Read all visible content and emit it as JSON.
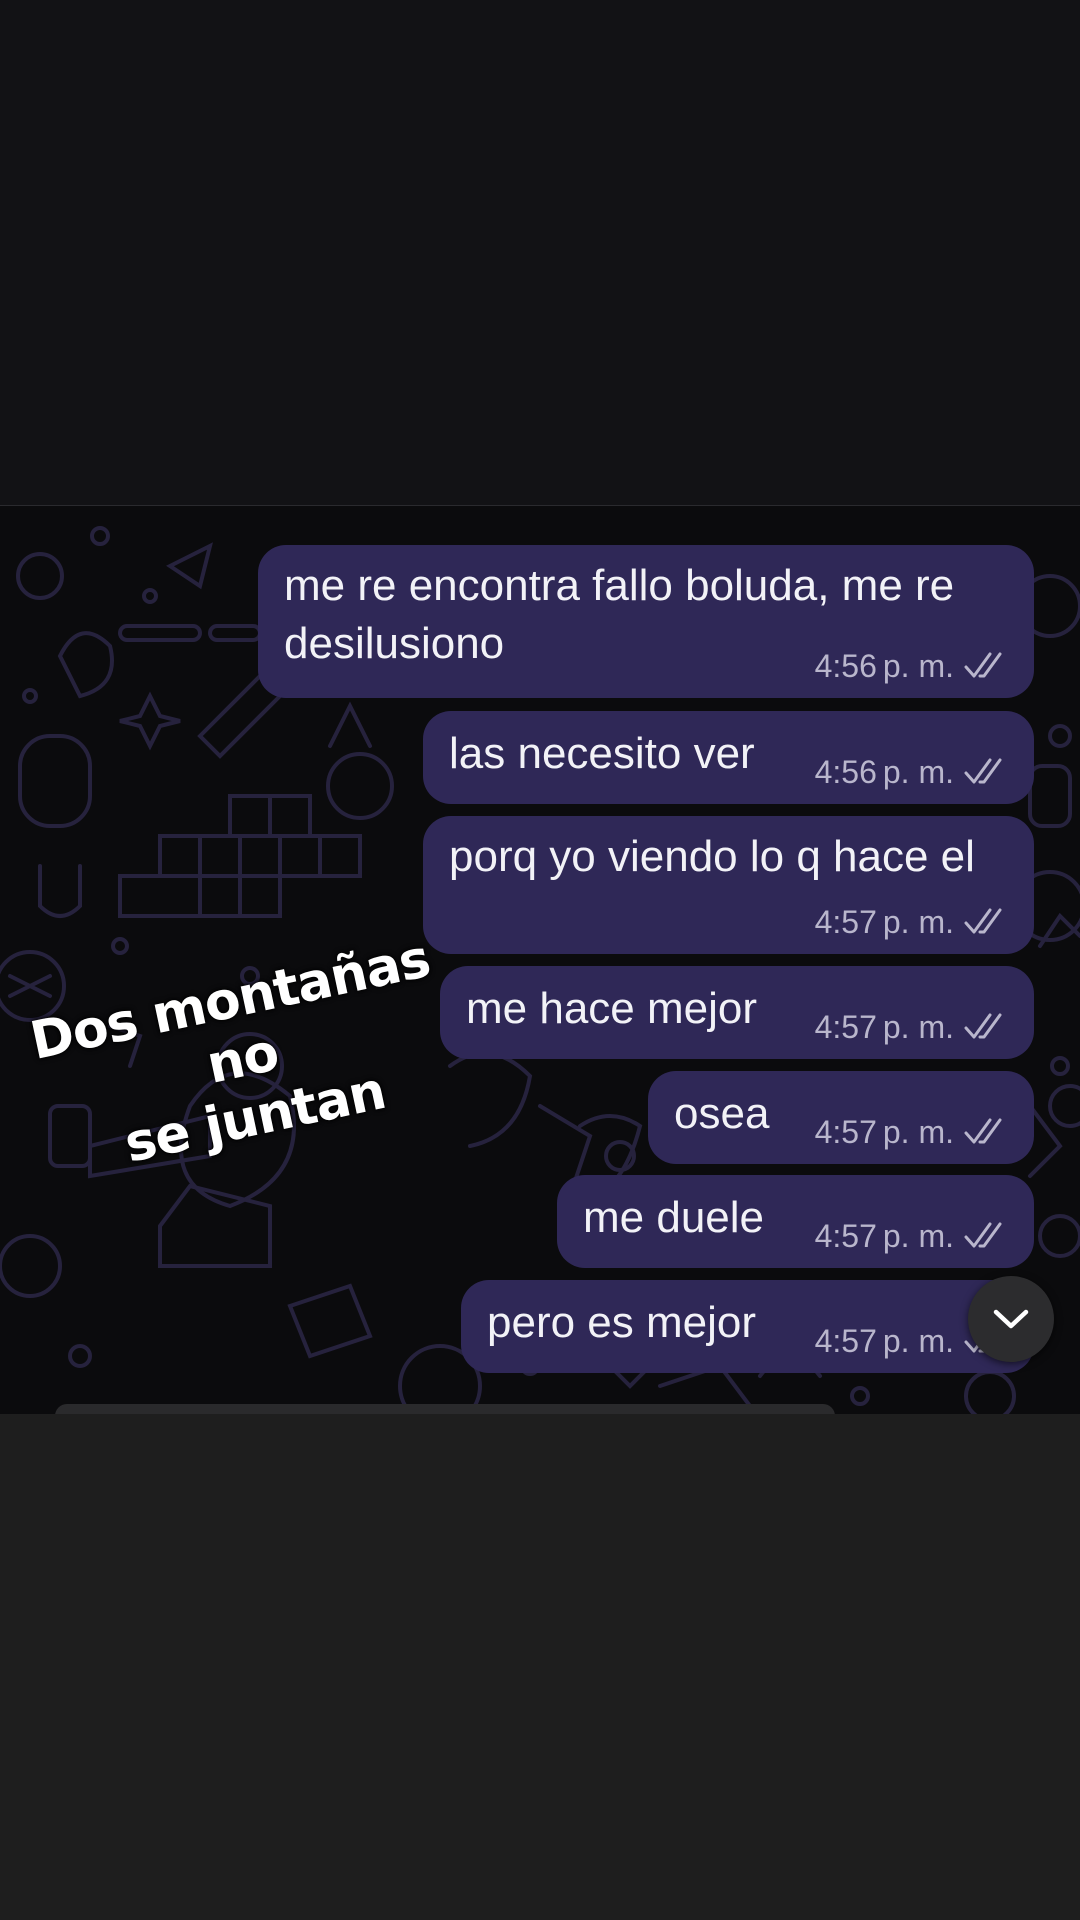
{
  "chat": {
    "messages": [
      {
        "text_line1": "me re encontra fallo boluda, me re",
        "text_line2": "desilusiono",
        "time": "4:56",
        "ampm": "p. m.",
        "status_icon": "double-check-icon"
      },
      {
        "text": "las necesito ver",
        "time": "4:56",
        "ampm": "p. m.",
        "status_icon": "double-check-icon"
      },
      {
        "text": "porq yo viendo lo q hace el",
        "time": "4:57",
        "ampm": "p. m.",
        "status_icon": "double-check-icon"
      },
      {
        "text": "me hace mejor",
        "time": "4:57",
        "ampm": "p. m.",
        "status_icon": "double-check-icon"
      },
      {
        "text": "osea",
        "time": "4:57",
        "ampm": "p. m.",
        "status_icon": "double-check-icon"
      },
      {
        "text": "me duele",
        "time": "4:57",
        "ampm": "p. m.",
        "status_icon": "double-check-icon"
      },
      {
        "text": "pero es mejor",
        "time": "4:57",
        "ampm": "p. m.",
        "status_icon": "double-check-icon"
      }
    ],
    "bubble_color": "#2f2857",
    "wallpaper_color": "#0b0b0d"
  },
  "sticker_text": {
    "line1": "Dos montañas no",
    "line2": "se juntan"
  },
  "controls": {
    "scroll_down_icon": "chevron-down-icon"
  }
}
